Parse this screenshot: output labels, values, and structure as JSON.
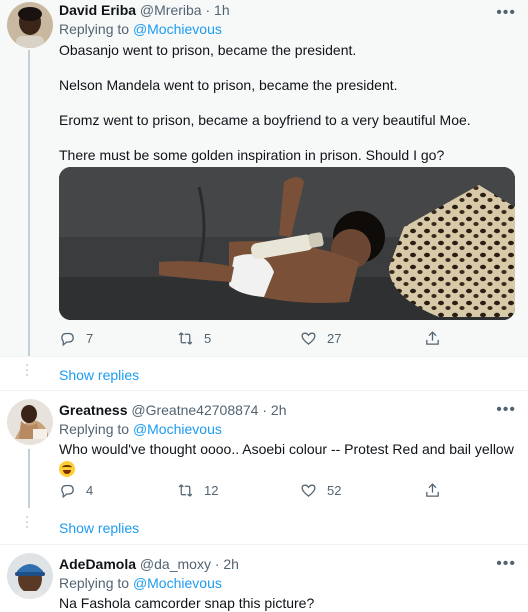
{
  "tweets": [
    {
      "name": "David Eriba",
      "handle": "@Mreriba",
      "time": "· 1h",
      "replying_label": "Replying to",
      "replying_to": "@Mochievous",
      "paragraphs": [
        "Obasanjo went to prison, became the president.",
        "Nelson Mandela went to prison, became the president.",
        "Eromz went to prison, became a boyfriend to a very beautiful Moe.",
        "There must be some golden inspiration in prison. Should I go?"
      ],
      "media_icon": "baby-on-leopard-print-pillow-photo",
      "stats": {
        "replies": "7",
        "retweets": "5",
        "likes": "27"
      }
    },
    {
      "name": "Greatness",
      "handle": "@Greatne42708874",
      "time": "· 2h",
      "replying_label": "Replying to",
      "replying_to": "@Mochievous",
      "text": "Who would've thought oooo..  Asoebi colour -- Protest Red and bail yellow",
      "emoji": "face-with-tears-of-joy",
      "stats": {
        "replies": "4",
        "retweets": "12",
        "likes": "52"
      }
    },
    {
      "name": "AdeDamola",
      "handle": "@da_moxy",
      "time": "· 2h",
      "replying_label": "Replying to",
      "replying_to": "@Mochievous",
      "text": "Na Fashola camcorder snap this picture?"
    }
  ],
  "show_replies_label": "Show replies",
  "more_label": "•••",
  "colors": {
    "link": "#1d9bf0",
    "muted": "#536471",
    "highlight": "#f7f9f9"
  }
}
